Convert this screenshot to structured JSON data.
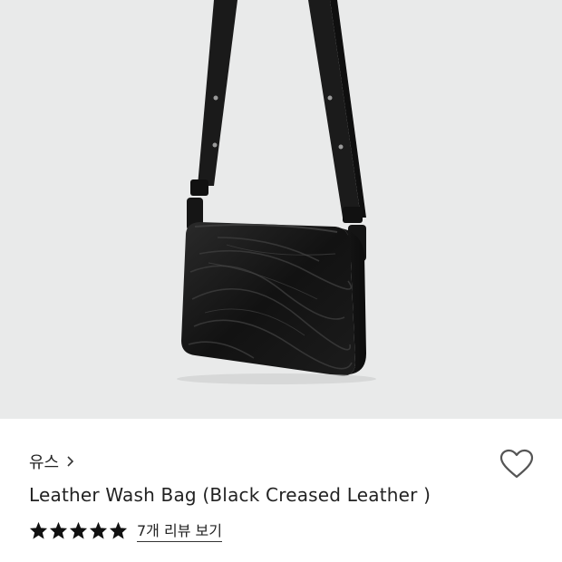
{
  "product": {
    "image_icon": "crossbody-bag-photo",
    "brand": "유스",
    "brand_chevron_icon": "chevron-right-icon",
    "wishlist_icon": "heart-outline-icon",
    "title": "Leather Wash Bag (Black Creased Leather )",
    "rating_stars": 5,
    "review_link": "7개 리뷰 보기"
  },
  "colors": {
    "hero_bg": "#e9eaea",
    "bag": "#141414",
    "text": "#222222",
    "heart_stroke": "#555555"
  }
}
